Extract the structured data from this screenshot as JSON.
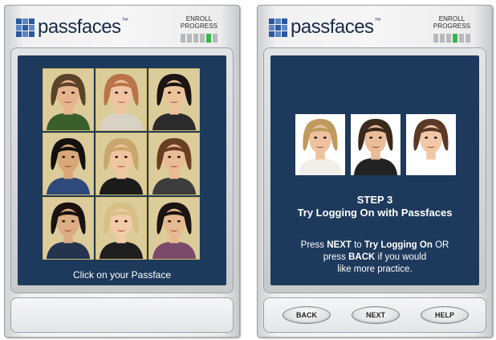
{
  "brand": {
    "name": "passfaces",
    "tm": "™"
  },
  "left_panel": {
    "enroll_label": "ENROLL PROGRESS",
    "progress": {
      "total_steps": 6,
      "current_step": 5
    },
    "instruction": "Click on your Passface",
    "faces": [
      {
        "hair": "#5a4328",
        "skin": "#e6b48e",
        "shirt": "#3a5f2a"
      },
      {
        "hair": "#b9744a",
        "skin": "#f0c4a2",
        "shirt": "#d8d2c4"
      },
      {
        "hair": "#1c1412",
        "skin": "#ecc49c",
        "shirt": "#2b2b2b"
      },
      {
        "hair": "#14100e",
        "skin": "#d8a878",
        "shirt": "#2e4a7a"
      },
      {
        "hair": "#c9a66a",
        "skin": "#f0c6a0",
        "shirt": "#1b1b1b"
      },
      {
        "hair": "#6a3e22",
        "skin": "#eabc96",
        "shirt": "#3c3c3c"
      },
      {
        "hair": "#1a1210",
        "skin": "#dcad84",
        "shirt": "#24344f"
      },
      {
        "hair": "#d8bf86",
        "skin": "#f2cca8",
        "shirt": "#1e1e1e"
      },
      {
        "hair": "#1a1412",
        "skin": "#e6ba90",
        "shirt": "#7a4a6a"
      }
    ]
  },
  "right_panel": {
    "enroll_label": "ENROLL PROGRESS",
    "progress": {
      "total_steps": 6,
      "current_step": 4
    },
    "faces": [
      {
        "hair": "#bf9a5e",
        "skin": "#eec2a0",
        "shirt": "#f2efe8"
      },
      {
        "hair": "#3a2a1c",
        "skin": "#eabc98",
        "shirt": "#222222"
      },
      {
        "hair": "#5a3a24",
        "skin": "#f0c8a6",
        "shirt": "#ffffff"
      }
    ],
    "step_title": "STEP 3",
    "step_subtitle": "Try Logging On with Passfaces",
    "instruction": {
      "p1": "Press ",
      "next_word": "NEXT",
      "p2": " to ",
      "try_phrase": "Try Logging On",
      "p3": " OR",
      "p4": "press ",
      "back_word": "BACK",
      "p5": " if you would",
      "line3": "like more practice."
    },
    "buttons": {
      "back": "BACK",
      "next": "NEXT",
      "help": "HELP"
    }
  }
}
